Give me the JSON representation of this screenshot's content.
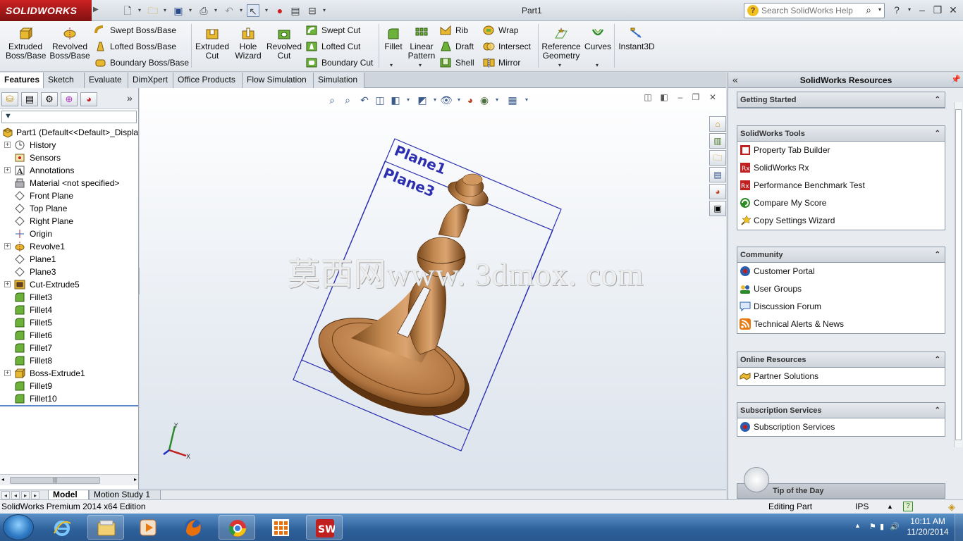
{
  "app": {
    "logo_text": "SOLIDWORKS",
    "document_title": "Part1",
    "search_placeholder": "Search SolidWorks Help"
  },
  "ribbon": {
    "extruded_boss": "Extruded\nBoss/Base",
    "revolved_boss": "Revolved\nBoss/Base",
    "swept_boss": "Swept Boss/Base",
    "lofted_boss": "Lofted Boss/Base",
    "boundary_boss": "Boundary Boss/Base",
    "extruded_cut": "Extruded\nCut",
    "hole_wizard": "Hole\nWizard",
    "revolved_cut": "Revolved\nCut",
    "swept_cut": "Swept Cut",
    "lofted_cut": "Lofted Cut",
    "boundary_cut": "Boundary Cut",
    "fillet": "Fillet",
    "linear_pattern": "Linear\nPattern",
    "rib": "Rib",
    "draft": "Draft",
    "shell": "Shell",
    "wrap": "Wrap",
    "intersect": "Intersect",
    "mirror": "Mirror",
    "reference_geometry": "Reference\nGeometry",
    "curves": "Curves",
    "instant3d": "Instant3D"
  },
  "tabs": [
    "Features",
    "Sketch",
    "Evaluate",
    "DimXpert",
    "Office Products",
    "Flow Simulation",
    "Simulation"
  ],
  "tree": {
    "root": "Part1  (Default<<Default>_Displa",
    "items": [
      {
        "label": "History",
        "icon": "history-icon",
        "expandable": true
      },
      {
        "label": "Sensors",
        "icon": "sensors-icon",
        "expandable": false
      },
      {
        "label": "Annotations",
        "icon": "annotations-icon",
        "expandable": true
      },
      {
        "label": "Material <not specified>",
        "icon": "material-icon",
        "expandable": false
      },
      {
        "label": "Front Plane",
        "icon": "plane-icon",
        "expandable": false
      },
      {
        "label": "Top Plane",
        "icon": "plane-icon",
        "expandable": false
      },
      {
        "label": "Right Plane",
        "icon": "plane-icon",
        "expandable": false
      },
      {
        "label": "Origin",
        "icon": "origin-icon",
        "expandable": false
      },
      {
        "label": "Revolve1",
        "icon": "revolve-icon",
        "expandable": true
      },
      {
        "label": "Plane1",
        "icon": "plane-icon",
        "expandable": false
      },
      {
        "label": "Plane3",
        "icon": "plane-icon",
        "expandable": false
      },
      {
        "label": "Cut-Extrude5",
        "icon": "cut-extrude-icon",
        "expandable": true
      },
      {
        "label": "Fillet3",
        "icon": "fillet-icon",
        "expandable": false
      },
      {
        "label": "Fillet4",
        "icon": "fillet-icon",
        "expandable": false
      },
      {
        "label": "Fillet5",
        "icon": "fillet-icon",
        "expandable": false
      },
      {
        "label": "Fillet6",
        "icon": "fillet-icon",
        "expandable": false
      },
      {
        "label": "Fillet7",
        "icon": "fillet-icon",
        "expandable": false
      },
      {
        "label": "Fillet8",
        "icon": "fillet-icon",
        "expandable": false
      },
      {
        "label": "Boss-Extrude1",
        "icon": "boss-extrude-icon",
        "expandable": true
      },
      {
        "label": "Fillet9",
        "icon": "fillet-icon",
        "expandable": false
      },
      {
        "label": "Fillet10",
        "icon": "fillet-icon",
        "expandable": false
      }
    ]
  },
  "viewport": {
    "plane1_label": "Plane1",
    "plane3_label": "Plane3",
    "watermark": "莫西网www. 3dmox. com",
    "triad_x": "X",
    "triad_y": "Y"
  },
  "resources": {
    "title": "SolidWorks Resources",
    "groups": [
      {
        "title": "Getting Started",
        "items": []
      },
      {
        "title": "SolidWorks Tools",
        "items": [
          "Property Tab Builder",
          "SolidWorks Rx",
          "Performance Benchmark Test",
          "Compare My Score",
          "Copy Settings Wizard"
        ]
      },
      {
        "title": "Community",
        "items": [
          "Customer Portal",
          "User Groups",
          "Discussion Forum",
          "Technical Alerts & News"
        ]
      },
      {
        "title": "Online Resources",
        "items": [
          "Partner Solutions"
        ]
      },
      {
        "title": "Subscription Services",
        "items": [
          "Subscription Services"
        ]
      }
    ],
    "tip_of_day": "Tip of the Day"
  },
  "model_tabs": [
    "Model",
    "Motion Study 1"
  ],
  "status": {
    "edition": "SolidWorks Premium 2014 x64 Edition",
    "mode": "Editing Part",
    "units": "IPS"
  },
  "taskbar": {
    "time": "10:11 AM",
    "date": "11/20/2014"
  },
  "colors": {
    "model_wood": "#b9804a",
    "plane_outline": "#2b2fb0",
    "accent_red": "#b01515"
  }
}
